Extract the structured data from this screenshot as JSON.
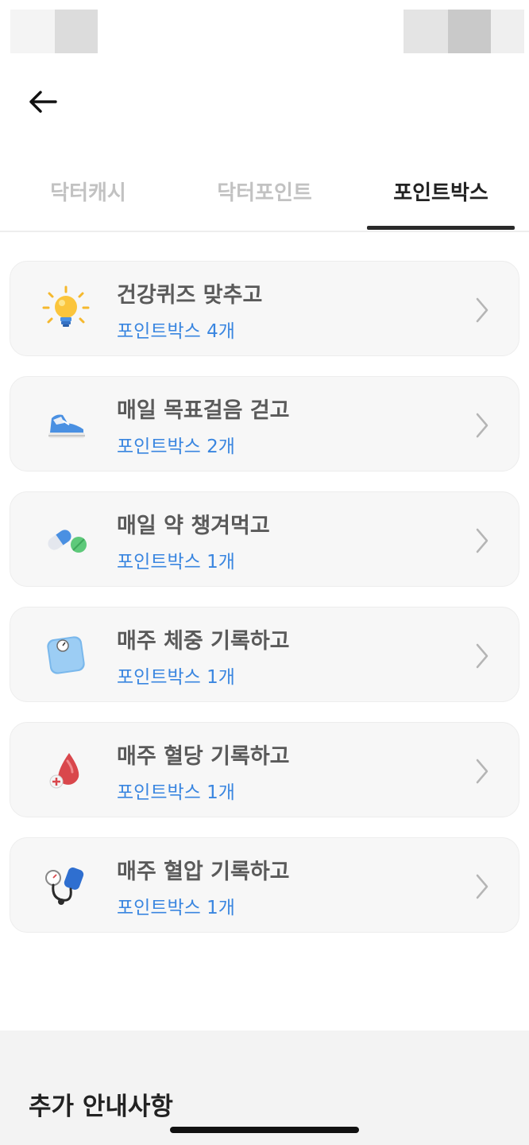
{
  "tabs": [
    {
      "label": "닥터캐시",
      "active": false
    },
    {
      "label": "닥터포인트",
      "active": false
    },
    {
      "label": "포인트박스",
      "active": true
    }
  ],
  "missions": [
    {
      "title": "건강퀴즈 맞추고",
      "reward": "포인트박스 4개",
      "icon": "lightbulb-icon"
    },
    {
      "title": "매일 목표걸음 걷고",
      "reward": "포인트박스 2개",
      "icon": "sneaker-icon"
    },
    {
      "title": "매일 약 챙겨먹고",
      "reward": "포인트박스 1개",
      "icon": "pill-icon"
    },
    {
      "title": "매주 체중 기록하고",
      "reward": "포인트박스 1개",
      "icon": "scale-icon"
    },
    {
      "title": "매주 혈당 기록하고",
      "reward": "포인트박스 1개",
      "icon": "blood-drop-icon"
    },
    {
      "title": "매주 혈압 기록하고",
      "reward": "포인트박스 1개",
      "icon": "blood-pressure-icon"
    }
  ],
  "info": {
    "title": "추가 안내사항"
  },
  "colors": {
    "accent": "#3a86e0",
    "active_tab": "#222222",
    "inactive_tab": "#c2c2c2"
  }
}
